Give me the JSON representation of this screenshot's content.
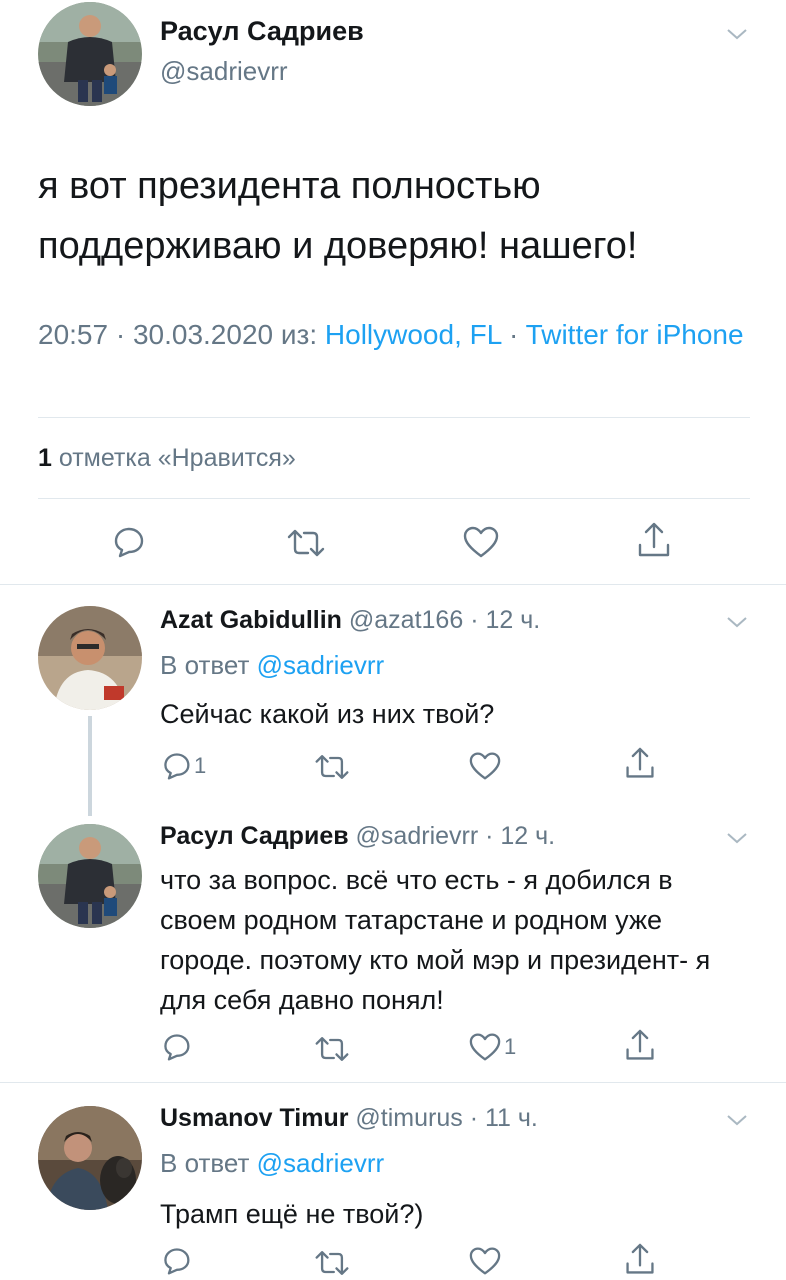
{
  "main_tweet": {
    "name": "Расул Садриев",
    "handle": "@sadrievrr",
    "text": "я вот президента полностью поддерживаю и доверяю! нашего!",
    "time": "20:57 · 30.03.2020 из: ",
    "location": "Hollywood, FL",
    "separator": " · ",
    "client": "Twitter for iPhone",
    "likes_count": "1",
    "likes_label": " отметка «Нравится»"
  },
  "replies": [
    {
      "name": "Azat Gabidullin",
      "handle_time": " @azat166 · 12 ч.",
      "reply_prefix": "В ответ ",
      "reply_to": "@sadrievrr",
      "text": "Сейчас какой из них твой?",
      "reply_count": "1",
      "like_count": ""
    },
    {
      "name": "Расул Садриев",
      "handle_time": " @sadrievrr · 12 ч.",
      "text": "что за вопрос. всё что есть - я добился в своем родном татарстане и родном уже городе. поэтому кто мой мэр и президент- я для себя давно понял!",
      "reply_count": "",
      "like_count": "1"
    },
    {
      "name": "Usmanov Timur",
      "handle_time": " @timurus · 11 ч.",
      "reply_prefix": "В ответ ",
      "reply_to": "@sadrievrr",
      "text": "Трамп ещё не твой?)",
      "reply_count": "",
      "like_count": ""
    }
  ],
  "icons": {
    "reply": "reply-bubble-icon",
    "retweet": "retweet-icon",
    "like": "heart-icon",
    "share": "share-icon",
    "more": "chevron-down-icon"
  },
  "colors": {
    "accent": "#1da1f2",
    "secondary_text": "#657786",
    "primary_text": "#14171a",
    "divider": "#e1e8ed"
  }
}
